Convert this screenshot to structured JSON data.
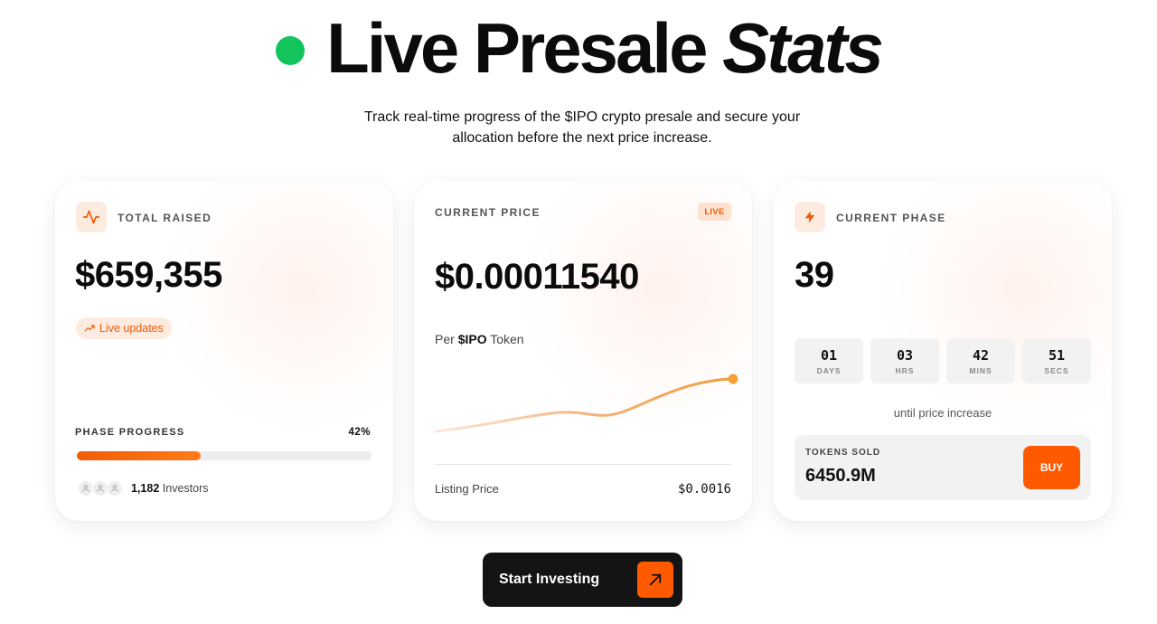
{
  "hero": {
    "title_main": "Live Presale",
    "title_italic": "Stats",
    "subtitle": "Track real-time progress of the $IPO crypto presale and secure your allocation before the next price increase.",
    "live_color": "#12c45a"
  },
  "card_raised": {
    "label": "TOTAL RAISED",
    "icon": "activity-icon",
    "value": "$659,355",
    "pill_text": "Live updates",
    "pill_icon": "trending-up-icon",
    "progress_label": "PHASE PROGRESS",
    "progress_pct": "42%",
    "progress_fraction": 0.42,
    "investors_count": "1,182",
    "investors_text": "Investors"
  },
  "card_price": {
    "label": "CURRENT PRICE",
    "badge": "LIVE",
    "value": "$0.00011540",
    "per_prefix": "Per",
    "per_token": "$IPO",
    "per_suffix": "Token",
    "listing_label": "Listing Price",
    "listing_value": "$0.0016"
  },
  "card_phase": {
    "label": "CURRENT PHASE",
    "icon": "lightning-icon",
    "value": "39",
    "timer": [
      {
        "num": "01",
        "unit": "DAYS"
      },
      {
        "num": "03",
        "unit": "HRS"
      },
      {
        "num": "42",
        "unit": "MINS"
      },
      {
        "num": "51",
        "unit": "SECS"
      }
    ],
    "until_text": "until price increase",
    "tokens_label": "TOKENS SOLD",
    "tokens_value": "6450.9M",
    "buy_label": "BUY"
  },
  "cta": {
    "label": "Start Investing",
    "icon": "arrow-up-right-icon"
  },
  "colors": {
    "accent": "#ff5a00",
    "accent_soft": "#fdebe0",
    "dark": "#141414"
  }
}
